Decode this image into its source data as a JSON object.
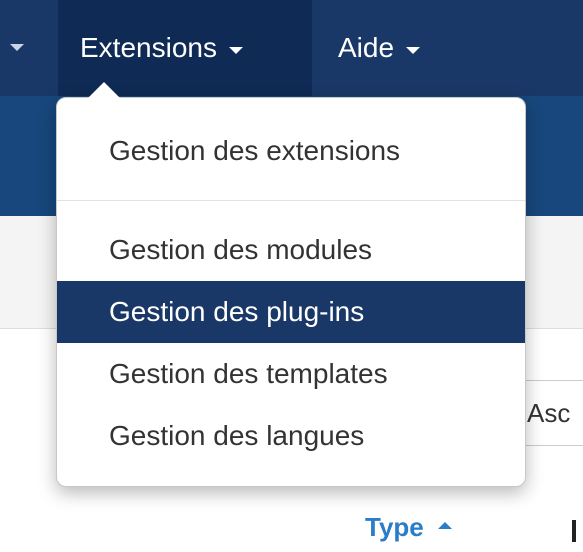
{
  "navbar": {
    "items": [
      {
        "label": "Extensions"
      },
      {
        "label": "Aide"
      }
    ]
  },
  "dropdown": {
    "group1": [
      {
        "label": "Gestion des extensions"
      }
    ],
    "group2": [
      {
        "label": "Gestion des modules"
      },
      {
        "label": "Gestion des plug-ins",
        "active": true
      },
      {
        "label": "Gestion des templates"
      },
      {
        "label": "Gestion des langues"
      }
    ]
  },
  "content": {
    "sort_select_partial": "Asc",
    "column_header": "Type"
  },
  "colors": {
    "navbar_bg": "#1a3867",
    "active_item_bg": "#1a3867",
    "link_blue": "#2a7dc9"
  }
}
